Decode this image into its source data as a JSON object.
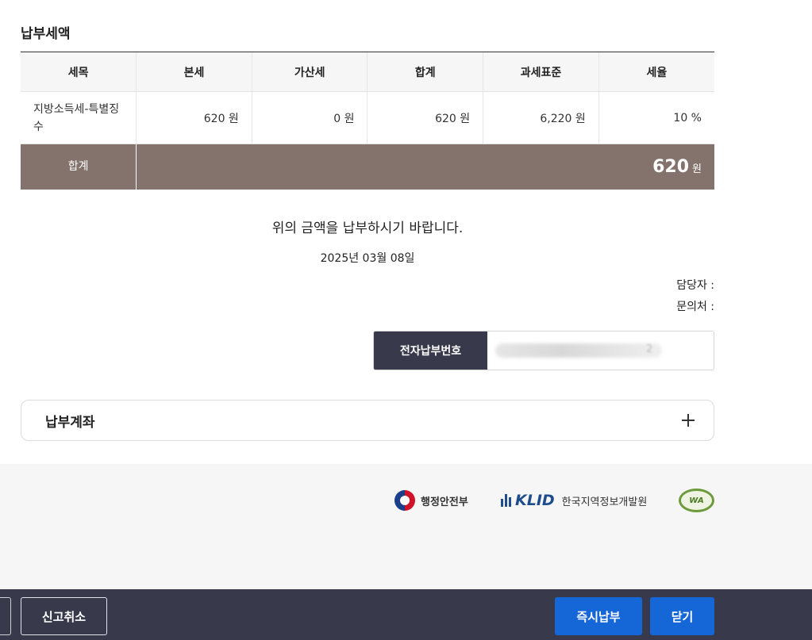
{
  "section_title": "납부세액",
  "table": {
    "headers": [
      "세목",
      "본세",
      "가산세",
      "합계",
      "과세표준",
      "세율"
    ],
    "rows": [
      {
        "item": "지방소득세-특별징수",
        "base_tax": "620 원",
        "penalty": "0 원",
        "sum": "620 원",
        "tax_base": "6,220 원",
        "rate": "10 %"
      }
    ],
    "total": {
      "label": "합계",
      "amount": "620",
      "unit": "원"
    }
  },
  "notice": {
    "message": "위의 금액을 납부하시기 바랍니다.",
    "date": "2025년 03월 08일",
    "manager_label": "담당자 :",
    "inquiry_label": "문의처 :"
  },
  "epay": {
    "label": "전자납부번호",
    "value_tail": "2"
  },
  "accordion": {
    "label": "납부계좌"
  },
  "footer": {
    "mois": "행정안전부",
    "klid_mark": "KLID",
    "klid_name": "한국지역정보개발원",
    "wa_mark": "WA"
  },
  "buttons": {
    "cancel_report": "신고취소",
    "pay_now": "즉시납부",
    "close": "닫기"
  },
  "colors": {
    "total_row": "#84736c",
    "epay_label": "#383a4b",
    "primary": "#1566d6",
    "bottom_bar": "#383a4b"
  }
}
